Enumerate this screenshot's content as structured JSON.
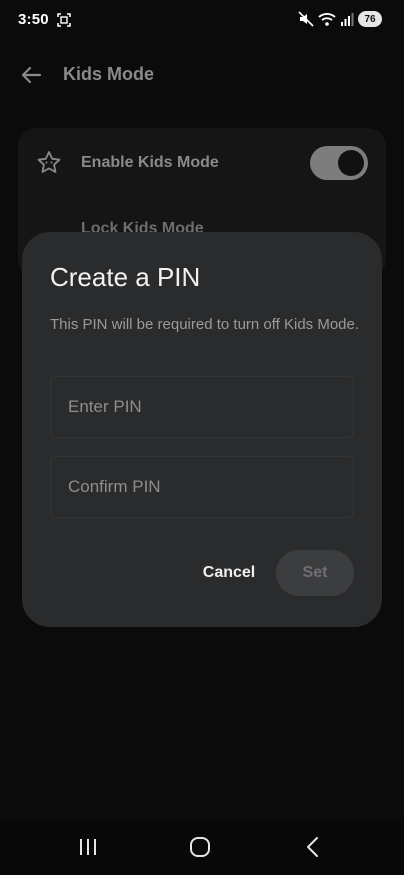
{
  "statusbar": {
    "time": "3:50",
    "battery": "76",
    "icons": [
      "screenshot-icon",
      "mute-icon",
      "wifi-icon",
      "signal-icon",
      "battery-icon"
    ]
  },
  "appbar": {
    "title": "Kids Mode",
    "back_icon": "back-arrow-icon"
  },
  "settings": {
    "rows": [
      {
        "label": "Enable Kids Mode",
        "icon": "star-icon",
        "toggle_on": true
      },
      {
        "label": "Lock Kids Mode"
      }
    ]
  },
  "dialog": {
    "title": "Create a PIN",
    "description": "This PIN will be required to turn off Kids Mode.",
    "fields": {
      "enter_pin": {
        "placeholder": "Enter PIN",
        "value": ""
      },
      "confirm_pin": {
        "placeholder": "Confirm PIN",
        "value": ""
      }
    },
    "buttons": {
      "cancel": "Cancel",
      "set": "Set"
    }
  },
  "navbar": {
    "icons": [
      "recents-icon",
      "home-icon",
      "back-icon"
    ]
  },
  "colors": {
    "background": "#0b0b0b",
    "dialog": "#2a2b2c",
    "set_button": "#3c3d3e"
  }
}
